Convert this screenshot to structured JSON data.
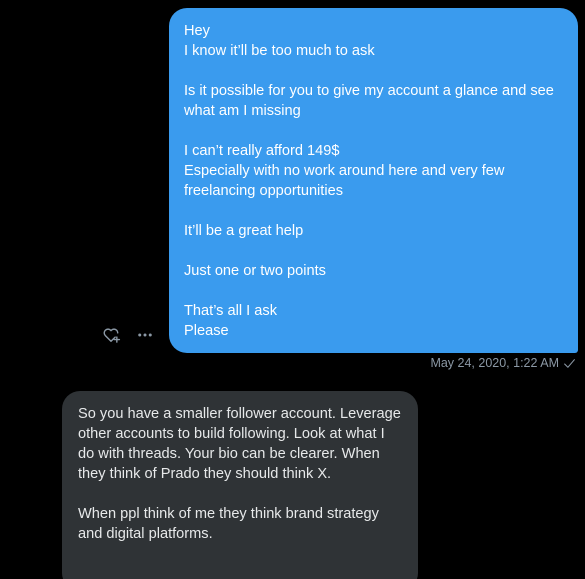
{
  "conversation": {
    "sent_message": {
      "text": "Hey\nI know it’ll be too much to ask\n\nIs it possible for you to give my account a glance and see what am I missing\n\nI can’t really afford 149$\nEspecially with no work around here and very few freelancing opportunities\n\nIt’ll be a great help\n\nJust one or two points\n\nThat’s all I ask\nPlease",
      "timestamp": "May 24, 2020, 1:22 AM",
      "status_icon": "check-icon"
    },
    "message_actions": {
      "react_icon": "heart-plus-icon",
      "more_icon": "more-horizontal-icon"
    },
    "received_message": {
      "text": "So you have a smaller follower account. Leverage other accounts to build following. Look at what I do with threads. Your bio can be clearer. When they think of Prado they should think X.\n\nWhen ppl think of me they think brand strategy and digital platforms."
    }
  },
  "colors": {
    "background": "#000000",
    "sent_bubble": "#3a9bee",
    "received_bubble": "#2f3336",
    "meta_text": "#8b98a5"
  }
}
